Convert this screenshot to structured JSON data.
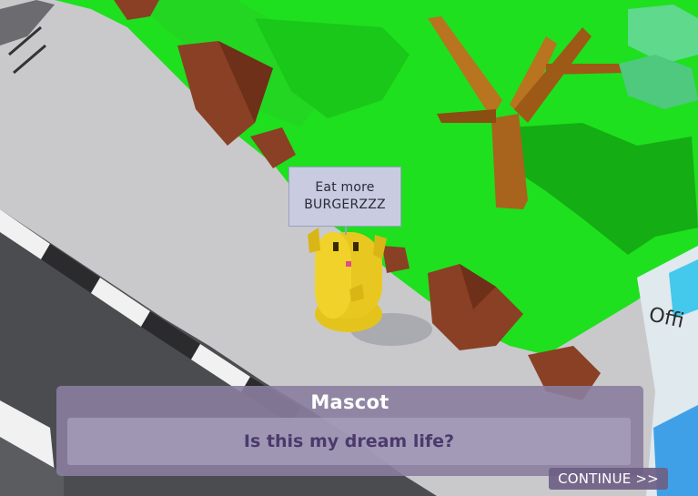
{
  "scene": {
    "sign_text_line1": "Eat more",
    "sign_text_line2": "BURGERZZZ",
    "storefront_sign": "Offi",
    "colors": {
      "grass": "#1ee01e",
      "pavement": "#c9c9cc",
      "road": "#4a4c50",
      "rock": "#8a4024",
      "trunk": "#a8641c",
      "mascot": "#e4c41c",
      "building": "#44c8ec"
    }
  },
  "dialog": {
    "speaker": "Mascot",
    "line": "Is this my dream life?",
    "continue_label": "CONTINUE >>"
  }
}
